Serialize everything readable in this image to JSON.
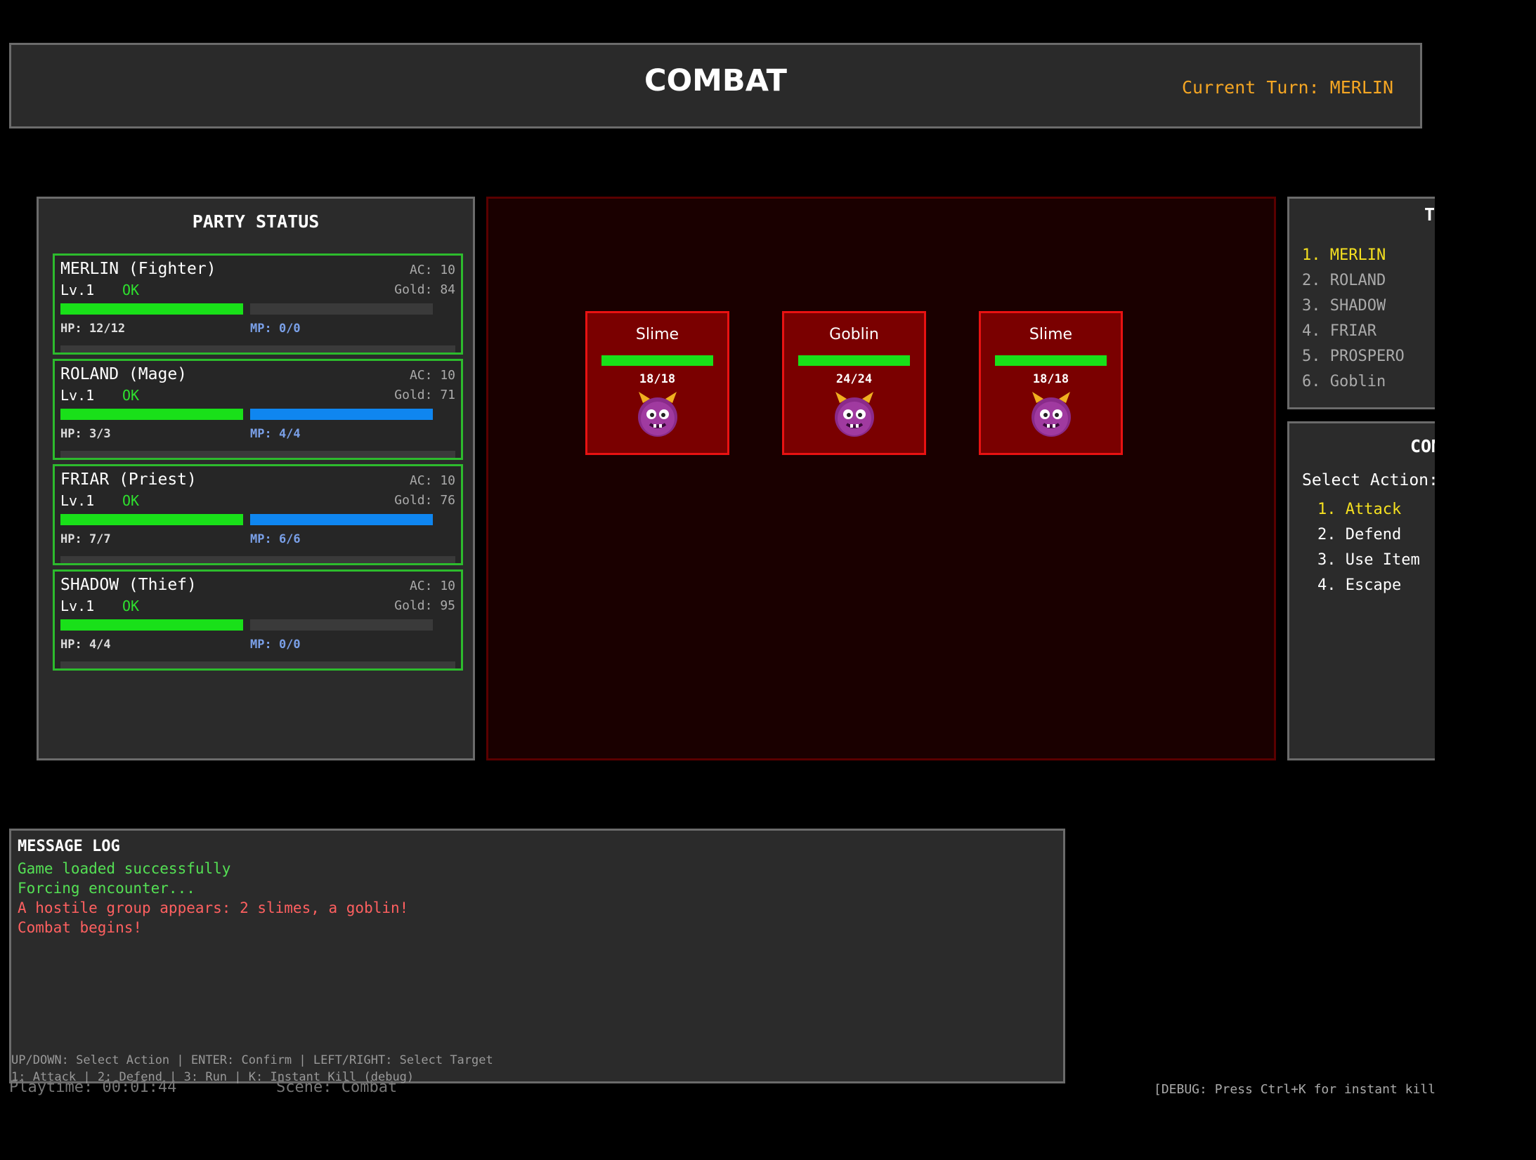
{
  "header": {
    "title": "COMBAT",
    "turn_label": "Current Turn: MERLIN"
  },
  "party": {
    "title": "PARTY STATUS",
    "members": [
      {
        "name": "MERLIN (Fighter)",
        "ac": "AC: 10",
        "level": "Lv.1",
        "status": "OK",
        "gold": "Gold: 84",
        "hp": "HP: 12/12",
        "mp": "MP: 0/0",
        "hp_fill": 1.0,
        "mp_fill": 0.0
      },
      {
        "name": "ROLAND (Mage)",
        "ac": "AC: 10",
        "level": "Lv.1",
        "status": "OK",
        "gold": "Gold: 71",
        "hp": "HP: 3/3",
        "mp": "MP: 4/4",
        "hp_fill": 1.0,
        "mp_fill": 1.0
      },
      {
        "name": "FRIAR (Priest)",
        "ac": "AC: 10",
        "level": "Lv.1",
        "status": "OK",
        "gold": "Gold: 76",
        "hp": "HP: 7/7",
        "mp": "MP: 6/6",
        "hp_fill": 1.0,
        "mp_fill": 1.0
      },
      {
        "name": "SHADOW (Thief)",
        "ac": "AC: 10",
        "level": "Lv.1",
        "status": "OK",
        "gold": "Gold: 95",
        "hp": "HP: 4/4",
        "mp": "MP: 0/0",
        "hp_fill": 1.0,
        "mp_fill": 0.0
      }
    ]
  },
  "enemies": [
    {
      "name": "Slime",
      "hp": "18/18",
      "hp_fill": 1.0,
      "icon": "demon-face-icon"
    },
    {
      "name": "Goblin",
      "hp": "24/24",
      "hp_fill": 1.0,
      "icon": "demon-face-icon"
    },
    {
      "name": "Slime",
      "hp": "18/18",
      "hp_fill": 1.0,
      "icon": "demon-face-icon"
    }
  ],
  "turn_order": {
    "title": "T",
    "items": [
      "1. MERLIN",
      "2. ROLAND",
      "3. SHADOW",
      "4. FRIAR",
      "5. PROSPERO",
      "6. Goblin"
    ]
  },
  "command": {
    "title": "COM",
    "prompt": "Select Action:",
    "items": [
      "1. Attack",
      "2. Defend",
      "3. Use Item",
      "4. Escape"
    ]
  },
  "log": {
    "title": "MESSAGE LOG",
    "lines": [
      "Game loaded successfully",
      "Forcing encounter...",
      "A hostile group appears: 2 slimes, a goblin!",
      "Combat begins!"
    ],
    "help1": "UP/DOWN: Select Action | ENTER: Confirm | LEFT/RIGHT: Select Target",
    "help2": "1: Attack | 2: Defend | 3: Run | K: Instant Kill (debug)"
  },
  "footer": {
    "playtime": "Playtime: 00:01:44",
    "scene": "Scene: Combat",
    "debug": "[DEBUG: Press Ctrl+K for instant kill]"
  },
  "colors": {
    "accent": "#f5a623",
    "hp": "#19e019",
    "mp": "#0f86f0",
    "enemy_bg": "#7a0000",
    "enemy_border": "#e81212"
  }
}
